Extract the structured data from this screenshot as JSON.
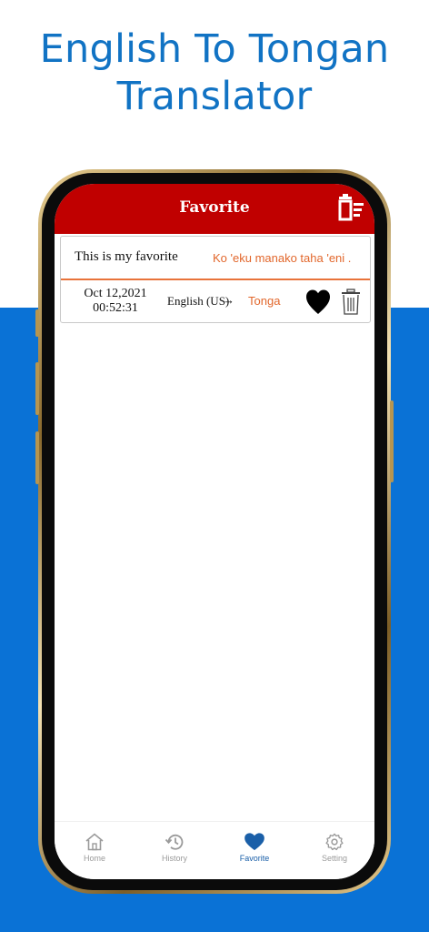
{
  "promo": {
    "title_line1": "English To Tongan",
    "title_line2": "Translator"
  },
  "header": {
    "title": "Favorite",
    "clear_icon": "trash-list-icon"
  },
  "favorites": [
    {
      "source_text": "This is my favorite",
      "translated_text": "Ko 'eku manako taha 'eni .",
      "date": "Oct 12,2021",
      "time": "00:52:31",
      "from_language": "English (US)",
      "arrow": "→",
      "to_language": "Tonga",
      "favorite_icon": "heart-filled-icon",
      "delete_icon": "trash-icon"
    }
  ],
  "tabs": [
    {
      "label": "Home",
      "icon": "home-icon",
      "active": false
    },
    {
      "label": "History",
      "icon": "history-icon",
      "active": false
    },
    {
      "label": "Favorite",
      "icon": "heart-icon",
      "active": true
    },
    {
      "label": "Setting",
      "icon": "gear-icon",
      "active": false
    }
  ],
  "colors": {
    "header_red": "#c00000",
    "accent_orange": "#e2672c",
    "promo_blue": "#1173c4",
    "band_blue": "#0a72d6",
    "tab_active": "#1a5fa8",
    "tab_inactive": "#9a9a9a"
  }
}
